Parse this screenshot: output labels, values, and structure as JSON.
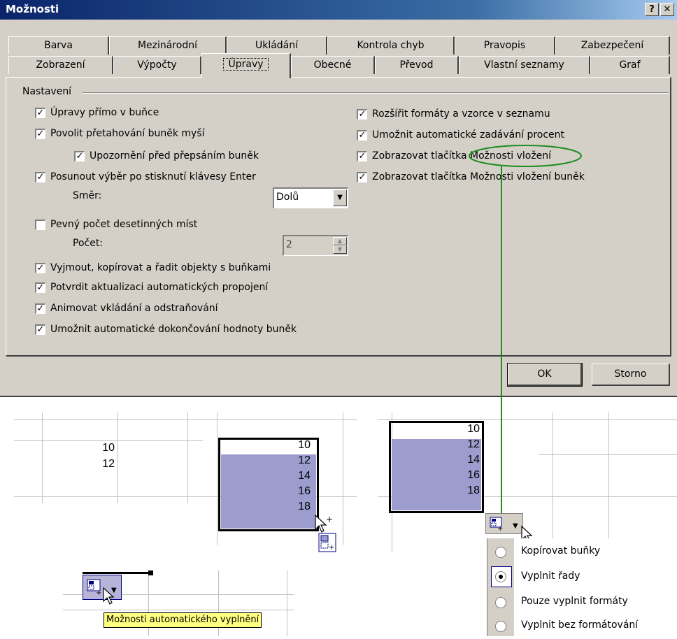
{
  "window": {
    "title": "Možnosti",
    "help_label": "?",
    "close_label": "✕"
  },
  "tabs": {
    "row1": [
      "Barva",
      "Mezinárodní",
      "Ukládání",
      "Kontrola chyb",
      "Pravopis",
      "Zabezpečení"
    ],
    "row2": [
      "Zobrazení",
      "Výpočty",
      "Úpravy",
      "Obecné",
      "Převod",
      "Vlastní seznamy",
      "Graf"
    ],
    "active": "Úpravy"
  },
  "settings": {
    "group_label": "Nastavení",
    "left": [
      {
        "label": "Úpravy přímo v buňce",
        "checked": true
      },
      {
        "label": "Povolit přetahování buněk myší",
        "checked": true
      },
      {
        "label": "Upozornění před přepsáním buněk",
        "checked": true
      },
      {
        "label": "Posunout výběr po stisknutí klávesy Enter",
        "checked": true
      },
      {
        "label": "Pevný počet desetinných míst",
        "checked": false
      },
      {
        "label": "Vyjmout, kopírovat a řadit objekty s buňkami",
        "checked": true
      },
      {
        "label": "Potvrdit aktualizaci automatických propojení",
        "checked": true
      },
      {
        "label": "Animovat vkládání a odstraňování",
        "checked": true
      },
      {
        "label": "Umožnit automatické dokončování hodnoty buněk",
        "checked": true
      }
    ],
    "right": [
      {
        "label": "Rozšířit formáty a vzorce v seznamu",
        "checked": true
      },
      {
        "label": "Umožnit automatické zadávání procent",
        "checked": true
      },
      {
        "label": "Zobrazovat tlačítka Možnosti vložení",
        "checked": true
      },
      {
        "label": "Zobrazovat tlačítka Možnosti vložení buněk",
        "checked": true
      }
    ],
    "direction_label": "Směr:",
    "direction_value": "Dolů",
    "places_label": "Počet:",
    "places_value": "2",
    "check_mark": "✓"
  },
  "buttons": {
    "ok": "OK",
    "cancel": "Storno"
  },
  "sheets": {
    "sheet1_values": [
      "10",
      "12"
    ],
    "sheet2_values": [
      "10",
      "12",
      "14",
      "16",
      "18"
    ],
    "sheet3_values": [
      "10",
      "12",
      "14",
      "16",
      "18"
    ]
  },
  "fill_menu": {
    "items": [
      {
        "label": "Kopírovat buňky",
        "selected": false
      },
      {
        "label": "Vyplnit řady",
        "selected": true
      },
      {
        "label": "Pouze vyplnit formáty",
        "selected": false
      },
      {
        "label": "Vyplnit bez formátování",
        "selected": false
      }
    ]
  },
  "tooltip": "Možnosti automatického vyplnění",
  "colors": {
    "dialog_face": "#d4d0c8",
    "title_bar": "#0a246a",
    "selection_fill": "#9c9ccf",
    "annotation": "#1e8c1e",
    "tooltip_bg": "#ffff80"
  }
}
